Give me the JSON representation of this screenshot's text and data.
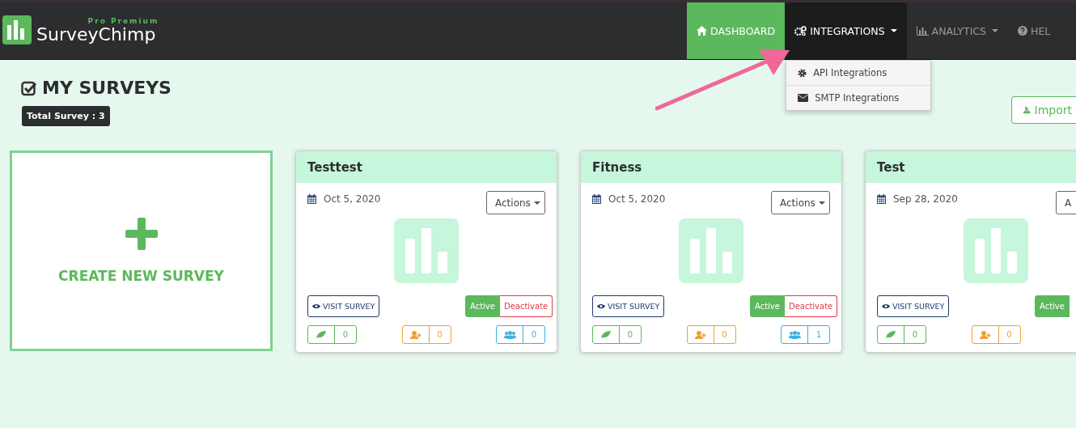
{
  "brand": {
    "tagline": "Pro Premium",
    "name": "SurveyChimp"
  },
  "nav": [
    {
      "label": "DASHBOARD",
      "selected": true,
      "caret": false,
      "open": false
    },
    {
      "label": "INTEGRATIONS",
      "selected": false,
      "caret": true,
      "open": true
    },
    {
      "label": "ANALYTICS",
      "selected": false,
      "caret": true,
      "open": false
    },
    {
      "label": "HEL",
      "selected": false,
      "caret": false,
      "open": false
    }
  ],
  "dropdown": [
    "API Integrations",
    "SMTP Integrations"
  ],
  "page": {
    "title": "MY SURVEYS",
    "total_badge": "Total Survey : 3",
    "import_button": "Import"
  },
  "create_card": {
    "label": "CREATE NEW SURVEY"
  },
  "surveys": [
    {
      "title": "Testtest",
      "date": "Oct 5, 2020",
      "actions": "Actions",
      "visit": "VISIT SURVEY",
      "active_label": "Active",
      "deactivate_label": "Deactivate",
      "active": true,
      "stats": [
        {
          "value": "0",
          "color": "#5cb85c"
        },
        {
          "value": "0",
          "color": "#f0a030"
        },
        {
          "value": "0",
          "color": "#3fb0dd"
        }
      ]
    },
    {
      "title": "Fitness",
      "date": "Oct 5, 2020",
      "actions": "Actions",
      "visit": "VISIT SURVEY",
      "active_label": "Active",
      "deactivate_label": "Deactivate",
      "active": true,
      "stats": [
        {
          "value": "0",
          "color": "#5cb85c"
        },
        {
          "value": "0",
          "color": "#f0a030"
        },
        {
          "value": "1",
          "color": "#3fb0dd"
        }
      ]
    },
    {
      "title": "Test",
      "date": "Sep 28, 2020",
      "actions": "A",
      "visit": "VISIT SURVEY",
      "active_label": "Active",
      "active": true,
      "stats": [
        {
          "value": "0",
          "color": "#5cb85c"
        },
        {
          "value": "0",
          "color": "#f0a030"
        }
      ]
    }
  ]
}
